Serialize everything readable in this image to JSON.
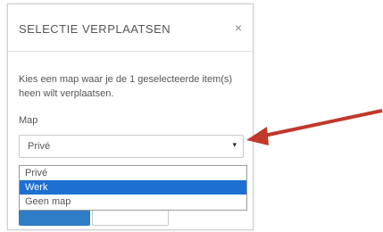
{
  "dialog": {
    "title": "SELECTIE VERPLAATSEN",
    "close_symbol": "×",
    "description": "Kies een map waar je de 1 geselecteerde item(s) heen wilt verplaatsen.",
    "map_label": "Map",
    "select": {
      "value": "Privé",
      "caret": "▾",
      "options": [
        "Privé",
        "Werk",
        "Geen map"
      ],
      "highlighted": "Werk"
    }
  },
  "annotation": {
    "arrow_color": "#c0392b",
    "arrow_target": "map-select"
  },
  "colors": {
    "highlight": "#1d6fd2",
    "primary_button": "#2f7dc4"
  }
}
